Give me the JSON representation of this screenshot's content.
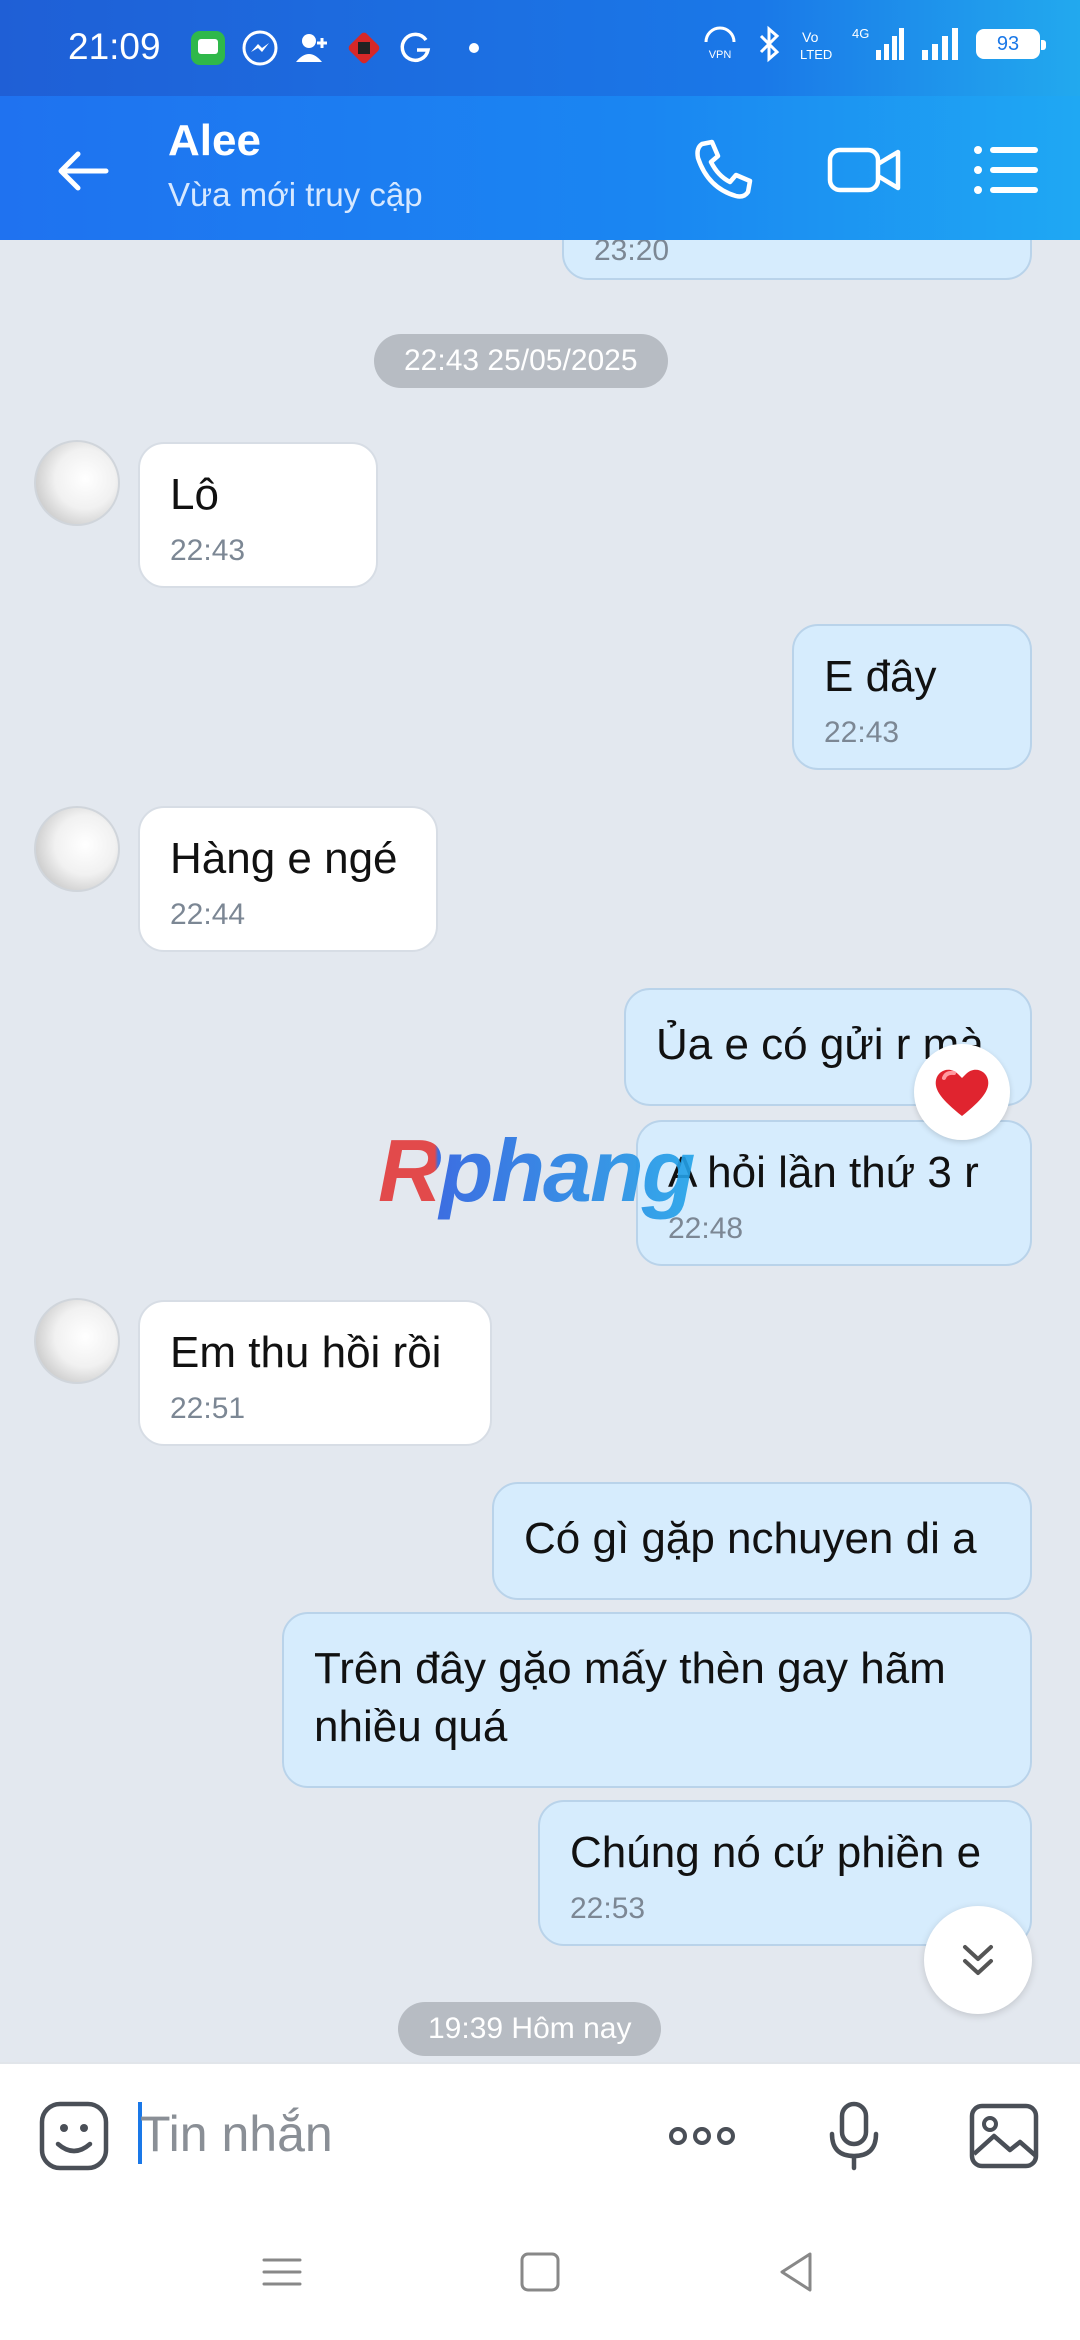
{
  "status_bar": {
    "time": "21:09",
    "battery": "93",
    "network": "4G",
    "icons": [
      "messages-app-icon",
      "messenger-icon",
      "add-contact-icon",
      "app-icon",
      "grammarly-icon",
      "dot-icon",
      "vpn-icon",
      "bluetooth-icon",
      "volte-icon",
      "signal-icon",
      "battery-icon"
    ]
  },
  "header": {
    "name": "Alee",
    "status": "Vừa mới truy cập"
  },
  "messages": [
    {
      "id": "partial",
      "side": "out",
      "text": "",
      "time": "23:20"
    },
    {
      "id": "m1",
      "side": "in",
      "text": "Lô",
      "time": "22:43"
    },
    {
      "id": "m2",
      "side": "out",
      "text": "E đây",
      "time": "22:43"
    },
    {
      "id": "m3",
      "side": "in",
      "text": "Hàng e ngé",
      "time": "22:44"
    },
    {
      "id": "m4",
      "side": "out",
      "text": "Ủa e có gửi r mà",
      "time": ""
    },
    {
      "id": "m5",
      "side": "out",
      "text": "A hỏi lần thứ 3 r",
      "time": "22:48"
    },
    {
      "id": "m6",
      "side": "in",
      "text": "Em thu hồi rồi",
      "time": "22:51"
    },
    {
      "id": "m7",
      "side": "out",
      "text": "Có gì gặp nchuyen di a",
      "time": ""
    },
    {
      "id": "m8",
      "side": "out",
      "text": "Trên đây gặo mấy thèn gay hãm nhiều quá",
      "time": ""
    },
    {
      "id": "m9",
      "side": "out",
      "text": "Chúng nó cứ phiền e",
      "time": "22:53"
    }
  ],
  "date_separators": {
    "first": "22:43 25/05/2025",
    "second": "19:39 Hôm nay"
  },
  "watermark": "Rphang",
  "input": {
    "placeholder": "Tin nhắn"
  },
  "colors": {
    "header": "#1a86f2",
    "incoming_bubble": "#ffffff",
    "outgoing_bubble": "#d6ecfd",
    "heart": "#e0242f"
  }
}
